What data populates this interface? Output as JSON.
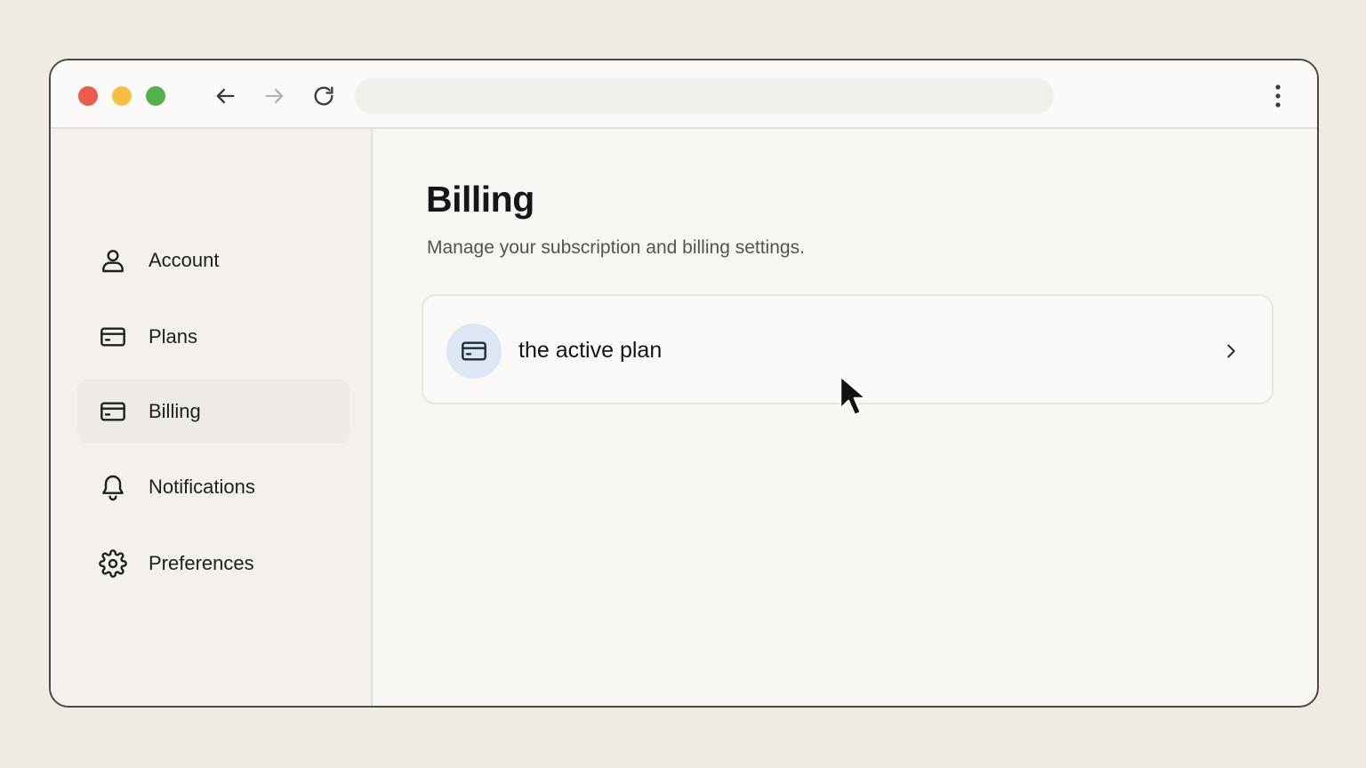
{
  "browser": {
    "url": "",
    "buttons": {
      "back": "arrow-left-icon",
      "forward": "arrow-right-icon",
      "reload": "reload-icon",
      "menu": "more-vertical-icon"
    },
    "traffic_lights": {
      "close": "#ee5b4d",
      "minimize": "#f6be45",
      "maximize": "#52b04f"
    }
  },
  "sidebar": {
    "items": [
      {
        "label": "Account",
        "icon": "user-icon",
        "active": false
      },
      {
        "label": "Plans",
        "icon": "credit-card-icon",
        "active": false
      },
      {
        "label": "Billing",
        "icon": "credit-card-icon",
        "active": true
      },
      {
        "label": "Notifications",
        "icon": "bell-icon",
        "active": false
      },
      {
        "label": "Preferences",
        "icon": "gear-icon",
        "active": false
      }
    ]
  },
  "main": {
    "title": "Billing",
    "subtitle": "Manage your subscription and billing settings.",
    "card": {
      "title": "the active plan",
      "icon": "credit-card-icon",
      "action_icon": "chevron-right-icon",
      "badge_color": "#dde6f5"
    }
  }
}
